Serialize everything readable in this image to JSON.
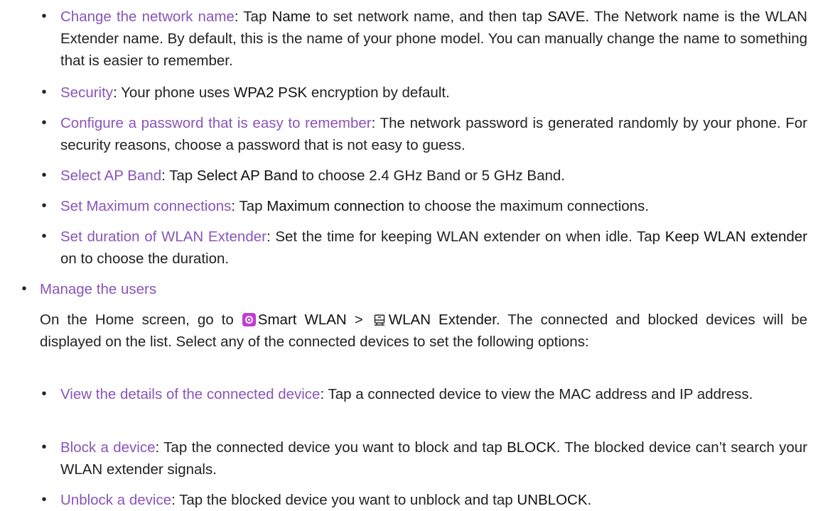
{
  "sub_items_top": [
    {
      "link": "Change the network name",
      "parts": [
        {
          "t": ": Tap ",
          "b": false
        },
        {
          "t": "Name",
          "b": true
        },
        {
          "t": " to set network name, and then tap ",
          "b": false
        },
        {
          "t": "SAVE",
          "b": true
        },
        {
          "t": ". The Network name is the WLAN Extender name. By default, this is the name of your phone model. You can manually change the name to something that is easier to remember.",
          "b": false
        }
      ]
    },
    {
      "link": "Security",
      "parts": [
        {
          "t": ": Your phone uses ",
          "b": false
        },
        {
          "t": "WPA2 PSK",
          "b": true
        },
        {
          "t": " encryption by default.",
          "b": false
        }
      ]
    },
    {
      "link": "Configure a password that is easy to remember",
      "parts": [
        {
          "t": ": The network password is generated randomly by your phone. For security reasons, choose a password that is not easy to guess.",
          "b": false
        }
      ]
    },
    {
      "link": "Select AP Band",
      "parts": [
        {
          "t": ": Tap ",
          "b": false
        },
        {
          "t": "Select AP Band",
          "b": true
        },
        {
          "t": " to choose 2.4 GHz Band or 5 GHz Band.",
          "b": false
        }
      ]
    },
    {
      "link": "Set Maximum connections",
      "parts": [
        {
          "t": ": Tap ",
          "b": false
        },
        {
          "t": "Maximum connection",
          "b": true
        },
        {
          "t": " to choose the maximum connections.",
          "b": false
        }
      ]
    },
    {
      "link": "Set duration of WLAN Extender",
      "parts": [
        {
          "t": ": Set the time for keeping WLAN extender on when idle. Tap ",
          "b": false
        },
        {
          "t": "Keep WLAN extender",
          "b": true
        },
        {
          "t": " on to choose the duration.",
          "b": false
        }
      ]
    }
  ],
  "manage": {
    "heading": "Manage the users",
    "para_start": "On the Home screen, go to ",
    "smart_wlan": "Smart WLAN",
    "sep": " > ",
    "wlan_extender": "WLAN Extender",
    "para_end": ". The connected and blocked devices will be displayed on the list. Select any of the connected devices to set the following options:",
    "smart_icon": "smart-wlan-icon",
    "extender_icon": "wlan-extender-icon",
    "icon_color": "#c23bd6"
  },
  "sub_items_bottom": [
    {
      "link": "View the details of the connected device",
      "parts": [
        {
          "t": ": Tap a connected device to view the MAC address and IP address.",
          "b": false
        }
      ]
    },
    {
      "link": "Block a device",
      "parts": [
        {
          "t": ": Tap the connected device you want to block and tap ",
          "b": false
        },
        {
          "t": "BLOCK",
          "b": true
        },
        {
          "t": ". The blocked device can’t search your WLAN extender signals.",
          "b": false
        }
      ]
    },
    {
      "link": "Unblock a device",
      "parts": [
        {
          "t": ": Tap the blocked device you want to unblock and tap ",
          "b": false
        },
        {
          "t": "UNBLOCK",
          "b": true
        },
        {
          "t": ".",
          "b": false
        }
      ]
    }
  ],
  "bullet": "•",
  "colors": {
    "link": "#8a55b8",
    "text": "#222222"
  }
}
